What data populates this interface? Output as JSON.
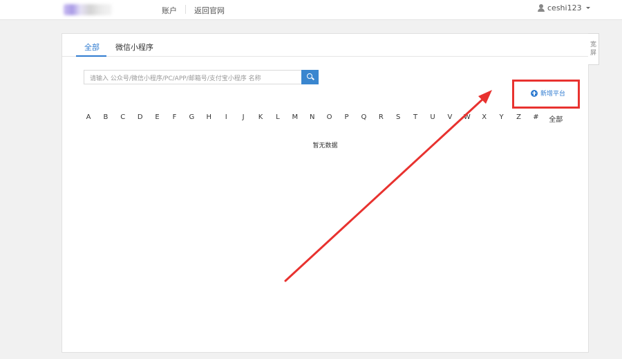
{
  "header": {
    "nav": [
      "账户",
      "返回官网"
    ],
    "user": "ceshi123"
  },
  "tabs": [
    {
      "label": "全部",
      "active": true
    },
    {
      "label": "微信小程序",
      "active": false
    }
  ],
  "search": {
    "placeholder": "请输入 公众号/微信小程序/PC/APP/邮箱号/支付宝小程序 名称"
  },
  "add_button": "新增平台",
  "letters": [
    "A",
    "B",
    "C",
    "D",
    "E",
    "F",
    "G",
    "H",
    "I",
    "J",
    "K",
    "L",
    "M",
    "N",
    "O",
    "P",
    "Q",
    "R",
    "S",
    "T",
    "U",
    "V",
    "W",
    "X",
    "Y",
    "Z",
    "#",
    "全部"
  ],
  "empty_text": "暂无数据",
  "wide_toggle": [
    "宽",
    "屏"
  ],
  "colors": {
    "accent": "#2f7bd0",
    "search_button": "#3a86cf",
    "annotation": "#e8322f"
  }
}
